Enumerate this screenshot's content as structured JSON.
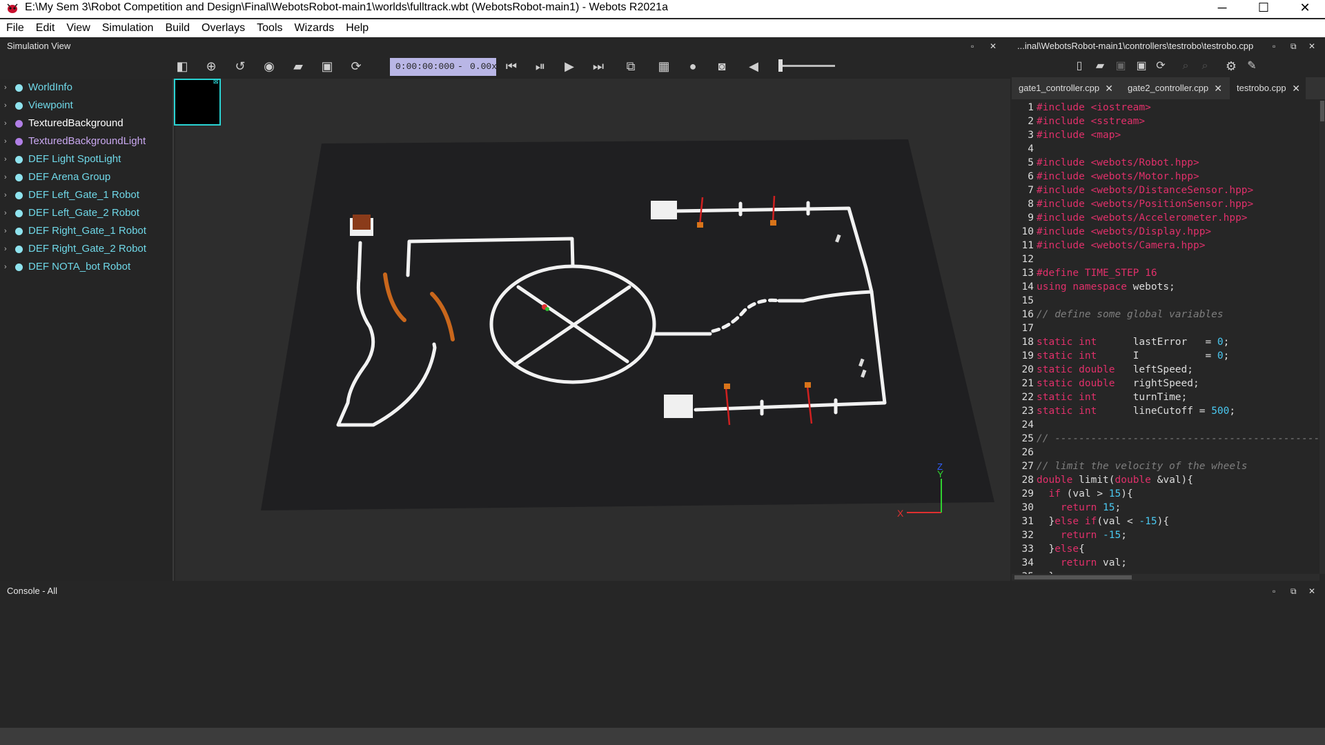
{
  "window": {
    "title": "E:\\My Sem 3\\Robot Competition and Design\\Final\\WebotsRobot-main1\\worlds\\fulltrack.wbt (WebotsRobot-main1) - Webots R2021a",
    "minimize": "─",
    "maximize": "☐",
    "close": "✕"
  },
  "menu": [
    "File",
    "Edit",
    "View",
    "Simulation",
    "Build",
    "Overlays",
    "Tools",
    "Wizards",
    "Help"
  ],
  "simulation_view": {
    "title": "Simulation View",
    "time": "0:00:00:000",
    "separator": "-",
    "speed": "0.00x",
    "float_btn": "▫",
    "close_btn": "✕"
  },
  "scene_tree": [
    {
      "label": "WorldInfo",
      "color": "#6fd8e8",
      "dot": "#8fe3ee",
      "bold": false
    },
    {
      "label": "Viewpoint",
      "color": "#6fd8e8",
      "dot": "#8fe3ee",
      "bold": false
    },
    {
      "label": "TexturedBackground",
      "color": "#ffffff",
      "dot": "#b17fe6",
      "bold": false
    },
    {
      "label": "TexturedBackgroundLight",
      "color": "#c9a8f0",
      "dot": "#b17fe6",
      "bold": false
    },
    {
      "label": "DEF Light SpotLight",
      "color": "#6fd8e8",
      "dot": "#8fe3ee",
      "bold": false
    },
    {
      "label": "DEF Arena Group",
      "color": "#6fd8e8",
      "dot": "#8fe3ee",
      "bold": false
    },
    {
      "label": "DEF Left_Gate_1 Robot",
      "color": "#6fd8e8",
      "dot": "#8fe3ee",
      "bold": false
    },
    {
      "label": "DEF Left_Gate_2 Robot",
      "color": "#6fd8e8",
      "dot": "#8fe3ee",
      "bold": false
    },
    {
      "label": "DEF Right_Gate_1 Robot",
      "color": "#6fd8e8",
      "dot": "#8fe3ee",
      "bold": false
    },
    {
      "label": "DEF Right_Gate_2 Robot",
      "color": "#6fd8e8",
      "dot": "#8fe3ee",
      "bold": false
    },
    {
      "label": "DEF NOTA_bot Robot",
      "color": "#6fd8e8",
      "dot": "#8fe3ee",
      "bold": false
    }
  ],
  "axes": {
    "x": "X",
    "y": "Y",
    "z": "Z"
  },
  "editor": {
    "path": "...inal\\WebotsRobot-main1\\controllers\\testrobo\\testrobo.cpp",
    "tabs": [
      {
        "label": "gate1_controller.cpp",
        "active": false
      },
      {
        "label": "gate2_controller.cpp",
        "active": false
      },
      {
        "label": "testrobo.cpp",
        "active": true
      }
    ],
    "tab_close": "✕",
    "lines": [
      [
        [
          "inc",
          "#include <iostream>"
        ]
      ],
      [
        [
          "inc",
          "#include <sstream>"
        ]
      ],
      [
        [
          "inc",
          "#include <map>"
        ]
      ],
      [],
      [
        [
          "inc",
          "#include <webots/Robot.hpp>"
        ]
      ],
      [
        [
          "inc",
          "#include <webots/Motor.hpp>"
        ]
      ],
      [
        [
          "inc",
          "#include <webots/DistanceSensor.hpp>"
        ]
      ],
      [
        [
          "inc",
          "#include <webots/PositionSensor.hpp>"
        ]
      ],
      [
        [
          "inc",
          "#include <webots/Accelerometer.hpp>"
        ]
      ],
      [
        [
          "inc",
          "#include <webots/Display.hpp>"
        ]
      ],
      [
        [
          "inc",
          "#include <webots/Camera.hpp>"
        ]
      ],
      [],
      [
        [
          "inc",
          "#define TIME_STEP 16"
        ]
      ],
      [
        [
          "kw",
          "using namespace"
        ],
        [
          "t",
          " webots;"
        ]
      ],
      [],
      [
        [
          "cmt",
          "// define some global variables"
        ]
      ],
      [],
      [
        [
          "kw",
          "static int"
        ],
        [
          "t",
          "      lastError   = "
        ],
        [
          "num",
          "0"
        ],
        [
          "t",
          ";"
        ]
      ],
      [
        [
          "kw",
          "static int"
        ],
        [
          "t",
          "      I           = "
        ],
        [
          "num",
          "0"
        ],
        [
          "t",
          ";"
        ]
      ],
      [
        [
          "kw",
          "static double"
        ],
        [
          "t",
          "   leftSpeed;"
        ]
      ],
      [
        [
          "kw",
          "static double"
        ],
        [
          "t",
          "   rightSpeed;"
        ]
      ],
      [
        [
          "kw",
          "static int"
        ],
        [
          "t",
          "      turnTime;"
        ]
      ],
      [
        [
          "kw",
          "static int"
        ],
        [
          "t",
          "      lineCutoff = "
        ],
        [
          "num",
          "500"
        ],
        [
          "t",
          ";"
        ]
      ],
      [],
      [
        [
          "cmt",
          "// ------------------------------------------------"
        ]
      ],
      [],
      [
        [
          "cmt",
          "// limit the velocity of the wheels"
        ]
      ],
      [
        [
          "kw",
          "double"
        ],
        [
          "t",
          " limit("
        ],
        [
          "kw",
          "double"
        ],
        [
          "t",
          " &val){"
        ]
      ],
      [
        [
          "t",
          "  "
        ],
        [
          "kw",
          "if"
        ],
        [
          "t",
          " (val > "
        ],
        [
          "num",
          "15"
        ],
        [
          "t",
          "){"
        ]
      ],
      [
        [
          "t",
          "    "
        ],
        [
          "kw",
          "return"
        ],
        [
          "t",
          " "
        ],
        [
          "num",
          "15"
        ],
        [
          "t",
          ";"
        ]
      ],
      [
        [
          "t",
          "  }"
        ],
        [
          "kw",
          "else if"
        ],
        [
          "t",
          "(val < "
        ],
        [
          "num",
          "-15"
        ],
        [
          "t",
          "){"
        ]
      ],
      [
        [
          "t",
          "    "
        ],
        [
          "kw",
          "return"
        ],
        [
          "t",
          " "
        ],
        [
          "num",
          "-15"
        ],
        [
          "t",
          ";"
        ]
      ],
      [
        [
          "t",
          "  }"
        ],
        [
          "kw",
          "else"
        ],
        [
          "t",
          "{"
        ]
      ],
      [
        [
          "t",
          "    "
        ],
        [
          "kw",
          "return"
        ],
        [
          "t",
          " val;"
        ]
      ],
      [
        [
          "t",
          "  }"
        ]
      ]
    ]
  },
  "console": {
    "title": "Console - All"
  }
}
